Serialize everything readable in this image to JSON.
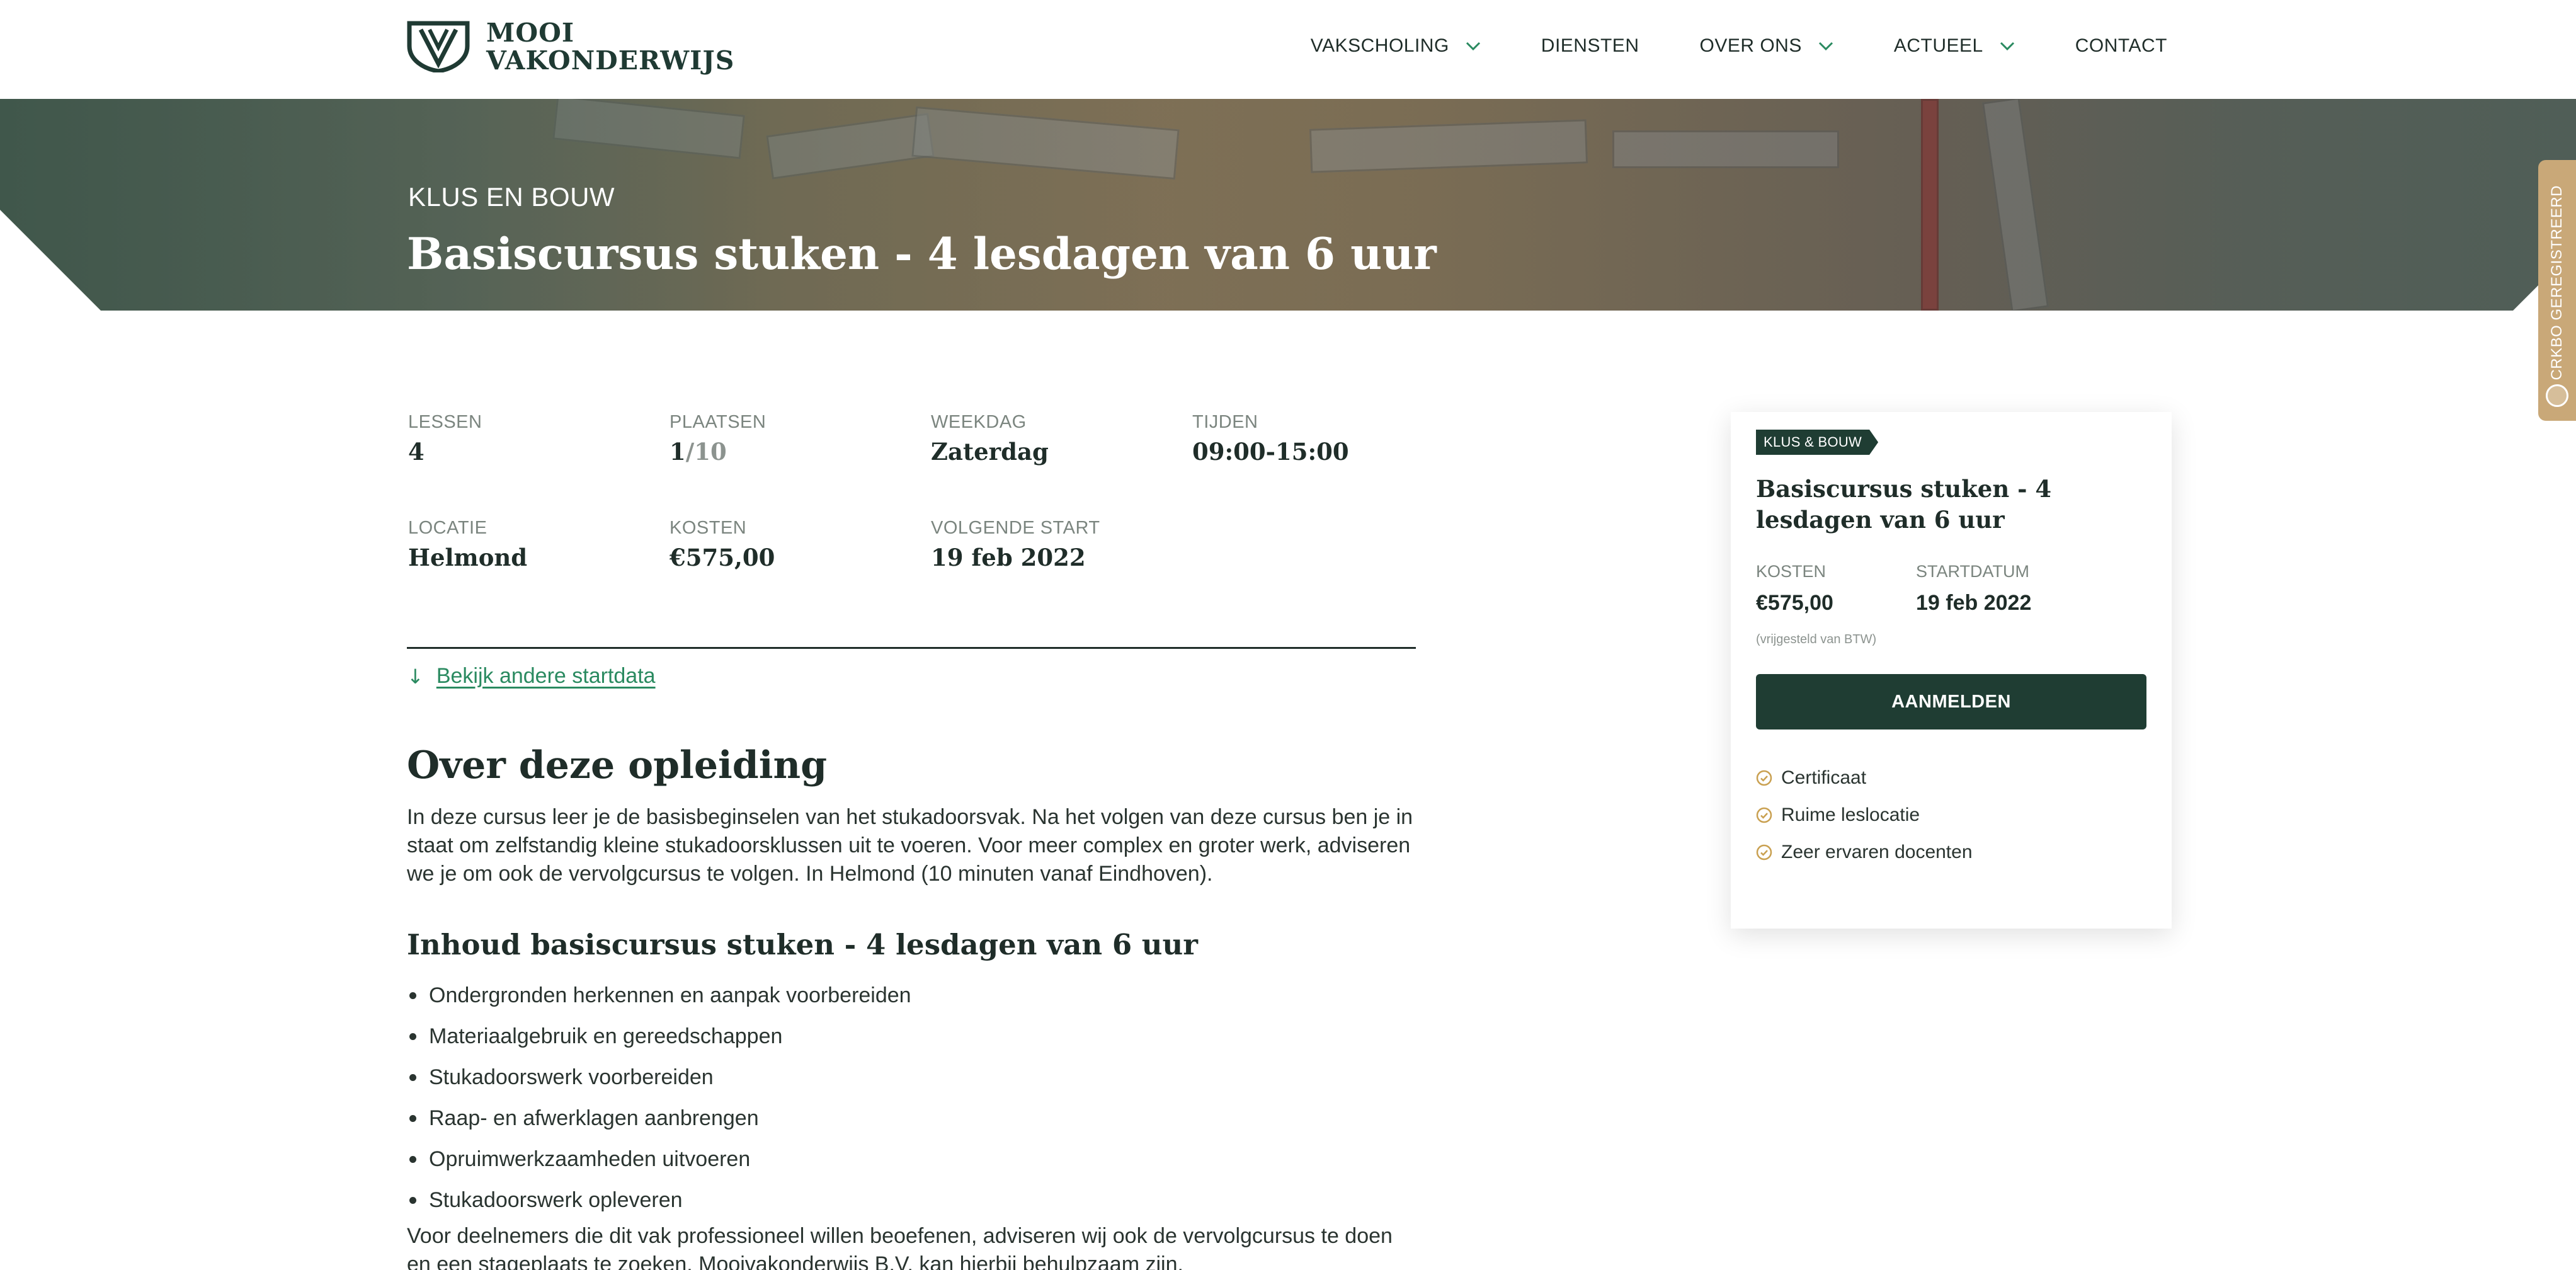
{
  "header": {
    "logo_line1": "MOOI",
    "logo_line2": "VAKONDERWIJS",
    "logo_icon": "shield-logo-icon",
    "nav": [
      {
        "label": "VAKSCHOLING",
        "has_dropdown": true
      },
      {
        "label": "DIENSTEN",
        "has_dropdown": false
      },
      {
        "label": "OVER ONS",
        "has_dropdown": true
      },
      {
        "label": "ACTUEEL",
        "has_dropdown": true
      },
      {
        "label": "CONTACT",
        "has_dropdown": false
      }
    ]
  },
  "hero": {
    "category": "KLUS EN BOUW",
    "title": "Basiscursus stuken - 4 lesdagen van 6 uur"
  },
  "side_tab": {
    "label": "CRKBO GEREGISTREERD",
    "icon": "crkbo-badge-icon"
  },
  "facts": {
    "lessons": {
      "label": "LESSEN",
      "value": "4"
    },
    "places": {
      "label": "PLAATSEN",
      "taken": "1",
      "total": "/10"
    },
    "weekday": {
      "label": "WEEKDAG",
      "value": "Zaterdag"
    },
    "times": {
      "label": "TIJDEN",
      "value": "09:00-15:00"
    },
    "location": {
      "label": "LOCATIE",
      "value": "Helmond"
    },
    "costs": {
      "label": "KOSTEN",
      "value": "€575,00"
    },
    "next_start": {
      "label": "VOLGENDE START",
      "value": "19 feb 2022"
    }
  },
  "other_dates": {
    "arrow": "↓",
    "label": "Bekijk andere startdata"
  },
  "content": {
    "about_heading": "Over deze opleiding",
    "about_text": "In deze cursus leer je de basisbeginselen van het stukadoorsvak. Na het volgen van deze cursus ben je in staat om zelfstandig kleine stukadoorsklussen uit te voeren. Voor meer complex en groter werk, adviseren we je om ook de vervolgcursus te volgen. In Helmond (10 minuten vanaf Eindhoven).",
    "contents_heading": "Inhoud basiscursus stuken - 4 lesdagen van 6 uur",
    "items": [
      "Ondergronden herkennen en aanpak voorbereiden",
      "Materiaalgebruik en gereedschappen",
      "Stukadoorswerk voorbereiden",
      "Raap- en afwerklagen aanbrengen",
      "Opruimwerkzaamheden uitvoeren",
      "Stukadoorswerk opleveren"
    ],
    "closing_text": "Voor deelnemers die dit vak professioneel willen beoefenen, adviseren wij ook de vervolgcursus te doen en een stageplaats te zoeken. Mooivakonderwijs B.V. kan hierbij behulpzaam zijn."
  },
  "card": {
    "tag": "KLUS & BOUW",
    "title": "Basiscursus stuken - 4 lesdagen van 6 uur",
    "cost_label": "KOSTEN",
    "cost_value": "€575,00",
    "start_label": "STARTDATUM",
    "start_value": "19 feb 2022",
    "vat_note": "(vrijgesteld van BTW)",
    "button": "AANMELDEN",
    "usps": [
      "Certificaat",
      "Ruime leslocatie",
      "Zeer ervaren docenten"
    ]
  },
  "colors": {
    "brand_dark": "#1f3d33",
    "link_green": "#2a8a60",
    "tab_gold": "#c9a878",
    "check_gold": "#c9a050"
  }
}
